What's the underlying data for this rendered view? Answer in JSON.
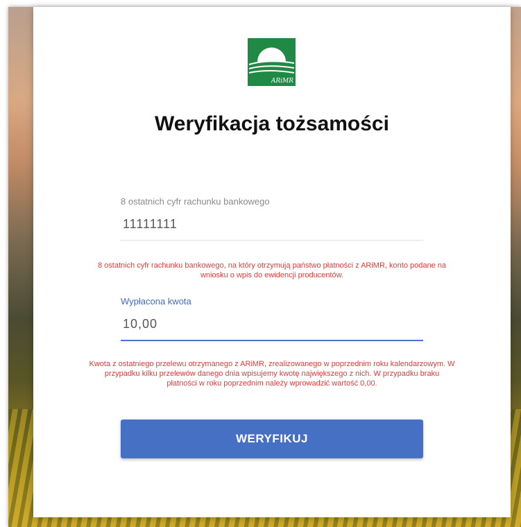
{
  "logo": {
    "text": "ARiMR",
    "colors": {
      "green": "#1f8a46",
      "white": "#ffffff"
    }
  },
  "title": "Weryfikacja tożsamości",
  "bank_account_field": {
    "label": "8 ostatnich cyfr rachunku bankowego",
    "value": "11111111",
    "hint": "8 ostatnich cyfr rachunku bankowego, na który otrzymują państwo płatności z ARiMR, konto podane na wniosku o wpis do ewidencji producentów."
  },
  "amount_field": {
    "label": "Wypłacona kwota",
    "value": "10,00",
    "hint": "Kwota z ostatniego przelewu otrzymanego z ARiMR, zrealizowanego w poprzednim roku kalendarzowym. W przypadku kilku przelewów danego dnia wpisujemy kwotę największego z nich. W przypadku braku płatności w roku poprzednim należy wprowadzić wartość 0,00."
  },
  "submit_button": {
    "label": "WERYFIKUJ"
  },
  "colors": {
    "accent": "#4570c4",
    "error": "#e03a3a",
    "label": "#8a8a8a"
  }
}
